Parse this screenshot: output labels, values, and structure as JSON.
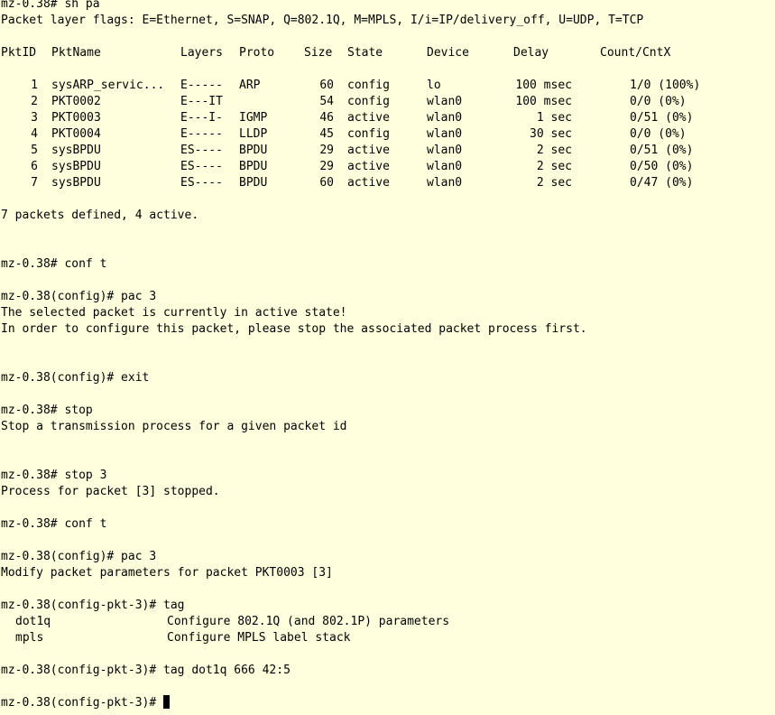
{
  "lines": [
    "mz-0.38# sh pa",
    "Packet layer flags: E=Ethernet, S=SNAP, Q=802.1Q, M=MPLS, I/i=IP/delivery_off, U=UDP, T=TCP"
  ],
  "table": {
    "headers": [
      "PktID",
      "PktName",
      "Layers",
      "Proto",
      "Size",
      "State",
      "Device",
      "Delay",
      "Count/CntX"
    ],
    "rows": [
      [
        "1",
        "sysARP_servic...",
        "E-----",
        "ARP",
        "60",
        "config",
        "lo",
        "100 msec",
        "1/0 (100%)"
      ],
      [
        "2",
        "PKT0002",
        "E---IT",
        "",
        "54",
        "config",
        "wlan0",
        "100 msec",
        "0/0 (0%)"
      ],
      [
        "3",
        "PKT0003",
        "E---I-",
        "IGMP",
        "46",
        "active",
        "wlan0",
        "1 sec",
        "0/51 (0%)"
      ],
      [
        "4",
        "PKT0004",
        "E-----",
        "LLDP",
        "45",
        "config",
        "wlan0",
        "30 sec",
        "0/0 (0%)"
      ],
      [
        "5",
        "sysBPDU",
        "ES----",
        "BPDU",
        "29",
        "active",
        "wlan0",
        "2 sec",
        "0/51 (0%)"
      ],
      [
        "6",
        "sysBPDU",
        "ES----",
        "BPDU",
        "29",
        "active",
        "wlan0",
        "2 sec",
        "0/50 (0%)"
      ],
      [
        "7",
        "sysBPDU",
        "ES----",
        "BPDU",
        "60",
        "active",
        "wlan0",
        "2 sec",
        "0/47 (0%)"
      ]
    ]
  },
  "after": [
    "7 packets defined, 4 active.",
    "mz-0.38# conf t",
    "mz-0.38(config)# pac 3",
    "The selected packet is currently in active state!",
    "In order to configure this packet, please stop the associated packet process first.",
    "mz-0.38(config)# exit",
    "mz-0.38# stop",
    "Stop a transmission process for a given packet id",
    "mz-0.38# stop 3",
    "Process for packet [3] stopped.",
    "mz-0.38# conf t",
    "mz-0.38(config)# pac 3",
    "Modify packet parameters for packet PKT0003 [3]",
    "mz-0.38(config-pkt-3)# tag",
    "mz-0.38(config-pkt-3)# tag dot1q 666 42:5"
  ],
  "help": [
    {
      "cmd": "dot1q",
      "desc": "Configure 802.1Q (and 802.1P) parameters"
    },
    {
      "cmd": "mpls",
      "desc": "Configure MPLS label stack"
    }
  ],
  "prompt": "mz-0.38(config-pkt-3)# "
}
